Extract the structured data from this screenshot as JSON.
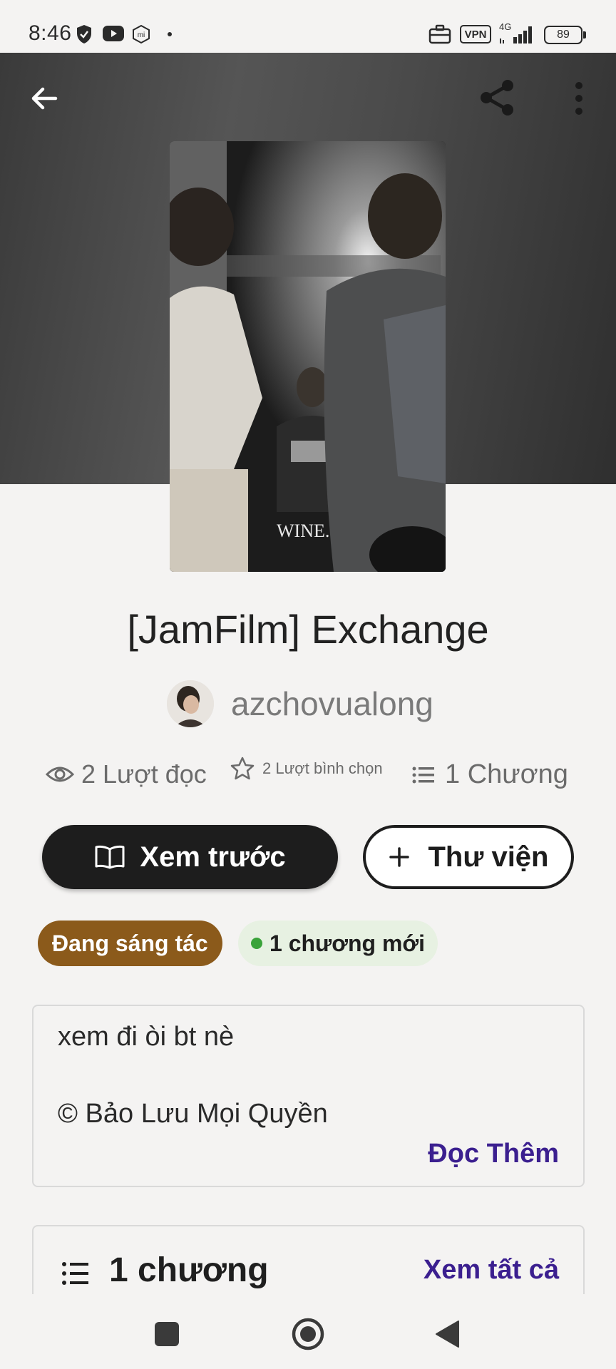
{
  "status_bar": {
    "time": "8:46",
    "vpn_label": "VPN",
    "network": "4G",
    "battery": "89"
  },
  "story": {
    "title": "[JamFilm] Exchange",
    "author": "azchovualong",
    "cover_caption": "WINE."
  },
  "stats": {
    "reads": "2 Lượt đọc",
    "votes": "2 Lượt bình chọn",
    "chapters": "1 Chương"
  },
  "actions": {
    "preview_label": "Xem trước",
    "library_label": "Thư viện"
  },
  "badges": {
    "status": "Đang sáng tác",
    "new_chapters": "1 chương mới"
  },
  "description": {
    "line1": "xem đi òi bt nè",
    "line2": "© Bảo Lưu Mọi Quyền",
    "read_more": "Đọc Thêm"
  },
  "chapters_section": {
    "title": "1 chương",
    "see_all": "Xem tất cả"
  },
  "colors": {
    "accent": "#3b1f8f",
    "status_badge": "#8b5a1b",
    "new_badge_bg": "#e7f1e2",
    "new_dot": "#3aa33a",
    "primary_button": "#1d1d1d"
  }
}
